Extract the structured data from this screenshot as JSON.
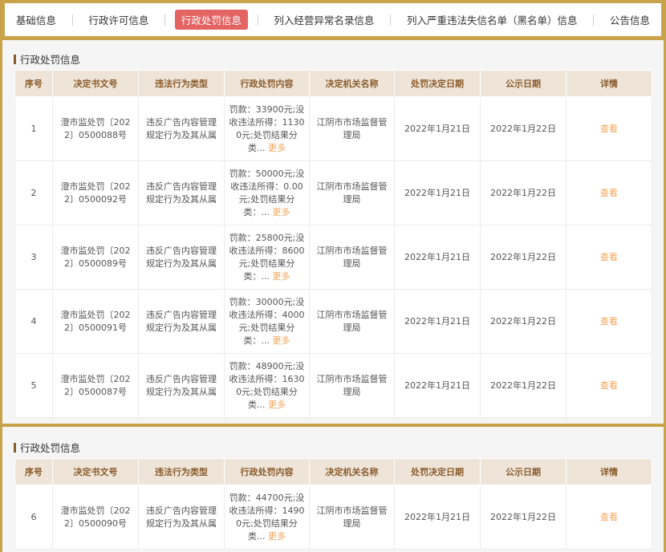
{
  "tabs": [
    {
      "label": "基础信息",
      "active": false
    },
    {
      "label": "行政许可信息",
      "active": false
    },
    {
      "label": "行政处罚信息",
      "active": true
    },
    {
      "label": "列入经营异常名录信息",
      "active": false
    },
    {
      "label": "列入严重违法失信名单（黑名单）信息",
      "active": false
    },
    {
      "label": "公告信息",
      "active": false
    }
  ],
  "sections": [
    {
      "title": "行政处罚信息",
      "columns": [
        "序号",
        "决定书文号",
        "违法行为类型",
        "行政处罚内容",
        "决定机关名称",
        "处罚决定日期",
        "公示日期",
        "详情"
      ],
      "rows": [
        {
          "no": "1",
          "doc": "澄市监处罚〔2022〕0500088号",
          "type": "违反广告内容管理规定行为及其从属",
          "content": "罚款：33900元;没收违法所得：11300元;处罚结果分类...",
          "more": "更多",
          "org": "江阴市市场监督管理局",
          "decision_date": "2022年1月21日",
          "publish_date": "2022年1月22日",
          "detail": "查看"
        },
        {
          "no": "2",
          "doc": "澄市监处罚〔2022〕0500092号",
          "type": "违反广告内容管理规定行为及其从属",
          "content": "罚款：50000元;没收违法所得：0.00元;处罚结果分类：...",
          "more": "更多",
          "org": "江阴市市场监督管理局",
          "decision_date": "2022年1月21日",
          "publish_date": "2022年1月22日",
          "detail": "查看"
        },
        {
          "no": "3",
          "doc": "澄市监处罚〔2022〕0500089号",
          "type": "违反广告内容管理规定行为及其从属",
          "content": "罚款：25800元;没收违法所得：8600元;处罚结果分类：...",
          "more": "更多",
          "org": "江阴市市场监督管理局",
          "decision_date": "2022年1月21日",
          "publish_date": "2022年1月22日",
          "detail": "查看"
        },
        {
          "no": "4",
          "doc": "澄市监处罚〔2022〕0500091号",
          "type": "违反广告内容管理规定行为及其从属",
          "content": "罚款：30000元;没收违法所得：4000元;处罚结果分类：...",
          "more": "更多",
          "org": "江阴市市场监督管理局",
          "decision_date": "2022年1月21日",
          "publish_date": "2022年1月22日",
          "detail": "查看"
        },
        {
          "no": "5",
          "doc": "澄市监处罚〔2022〕0500087号",
          "type": "违反广告内容管理规定行为及其从属",
          "content": "罚款：48900元;没收违法所得：16300元;处罚结果分类...",
          "more": "更多",
          "org": "江阴市市场监督管理局",
          "decision_date": "2022年1月21日",
          "publish_date": "2022年1月22日",
          "detail": "查看"
        }
      ]
    },
    {
      "title": "行政处罚信息",
      "columns": [
        "序号",
        "决定书文号",
        "违法行为类型",
        "行政处罚内容",
        "决定机关名称",
        "处罚决定日期",
        "公示日期",
        "详情"
      ],
      "rows": [
        {
          "no": "6",
          "doc": "澄市监处罚〔2022〕0500090号",
          "type": "违反广告内容管理规定行为及其从属",
          "content": "罚款：44700元;没收违法所得：14900元;处罚结果分类...",
          "more": "更多",
          "org": "江阴市市场监督管理局",
          "decision_date": "2022年1月21日",
          "publish_date": "2022年1月22日",
          "detail": "查看"
        }
      ]
    }
  ]
}
